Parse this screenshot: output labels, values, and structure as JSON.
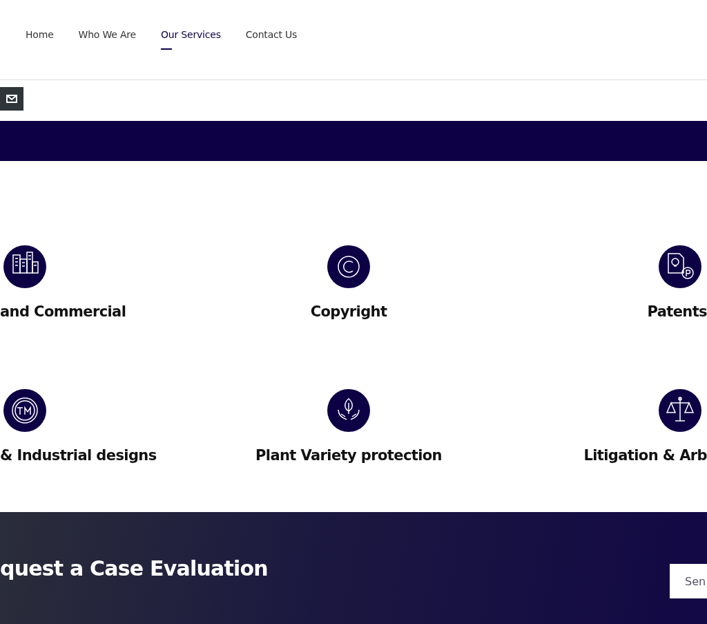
{
  "nav": [
    {
      "label": "Home",
      "selected": false
    },
    {
      "label": "Who We Are",
      "selected": false
    },
    {
      "label": "Our Services",
      "selected": true
    },
    {
      "label": "Contact Us",
      "selected": false
    }
  ],
  "services": [
    {
      "kind": "buildings",
      "title": "and Commercial"
    },
    {
      "kind": "copyright",
      "title": "Copyright"
    },
    {
      "kind": "patent",
      "title": "Patents"
    },
    {
      "kind": "trademark",
      "title": "& Industrial designs"
    },
    {
      "kind": "plant",
      "title": "Plant Variety protection"
    },
    {
      "kind": "scales",
      "title": "Litigation & Arb"
    }
  ],
  "evaluation": {
    "title": "quest a Case Evaluation",
    "field": {
      "placeholder": "Sen"
    }
  }
}
